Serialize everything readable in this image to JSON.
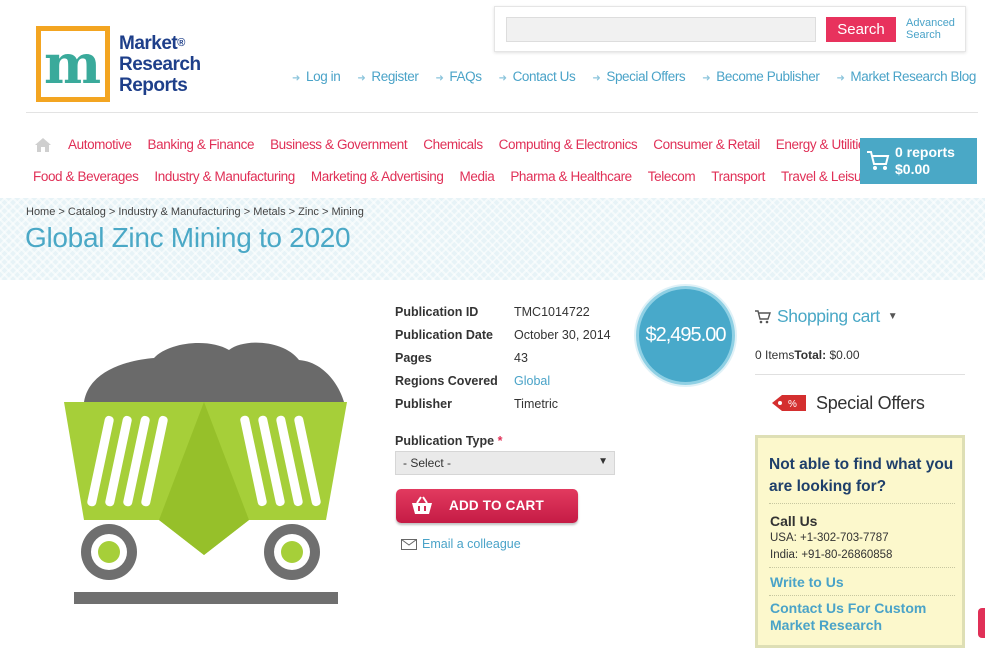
{
  "logo": {
    "letter": "m",
    "line1": "Market",
    "line2": "Research",
    "line3": "Reports",
    "reg": "®"
  },
  "search": {
    "value": "",
    "placeholder": "",
    "button": "Search",
    "advanced_line1": "Advanced",
    "advanced_line2": "Search"
  },
  "toplinks": [
    "Log in",
    "Register",
    "FAQs",
    "Contact Us",
    "Special Offers",
    "Become Publisher",
    "Market Research Blog"
  ],
  "categories_row1": [
    "Automotive",
    "Banking & Finance",
    "Business & Government",
    "Chemicals",
    "Computing & Electronics",
    "Consumer & Retail",
    "Energy & Utilities"
  ],
  "categories_row2": [
    "Food & Beverages",
    "Industry & Manufacturing",
    "Marketing & Advertising",
    "Media",
    "Pharma & Healthcare",
    "Telecom",
    "Transport",
    "Travel & Leisure"
  ],
  "cart": {
    "reports": "0 reports",
    "total": "$0.00"
  },
  "breadcrumb": [
    "Home",
    "Catalog",
    "Industry & Manufacturing",
    "Metals",
    "Zinc",
    "Mining"
  ],
  "title": "Global Zinc Mining to 2020",
  "details": [
    {
      "label": "Publication ID",
      "value": "TMC1014722",
      "link": false
    },
    {
      "label": "Publication Date",
      "value": "October 30, 2014",
      "link": false
    },
    {
      "label": "Pages",
      "value": "43",
      "link": false
    },
    {
      "label": "Regions Covered",
      "value": "Global",
      "link": true
    },
    {
      "label": "Publisher",
      "value": "Timetric",
      "link": false
    }
  ],
  "publication_type": {
    "label": "Publication Type",
    "required_mark": "*",
    "selected": "- Select -"
  },
  "add_to_cart": "ADD TO CART",
  "email_colleague": "Email a colleague",
  "price": "$2,495.00",
  "sidebar": {
    "shopping_cart_title": "Shopping cart",
    "items_text": "0 Items",
    "total_label": "Total:",
    "total_value": "$0.00",
    "special_offers": "Special Offers",
    "tag_text": "%",
    "help_question": "Not able to find what you are looking for?",
    "call_us": "Call Us",
    "usa_phone": "USA: +1-302-703-7787",
    "india_phone": "India: +91-80-26860858",
    "write_to_us": "Write to Us",
    "custom_research": "Contact Us For Custom Market Research"
  },
  "colors": {
    "accent_pink": "#e03057",
    "accent_blue": "#4aa8c6",
    "logo_orange": "#f3a521",
    "logo_navy": "#1e3f8a",
    "cart_green": "#a6cf39",
    "cart_grey": "#727272"
  },
  "icons": [
    "home-icon",
    "cart-icon",
    "basket-icon",
    "mail-icon",
    "tag-icon",
    "chevron-down-icon",
    "arrow-icon"
  ]
}
